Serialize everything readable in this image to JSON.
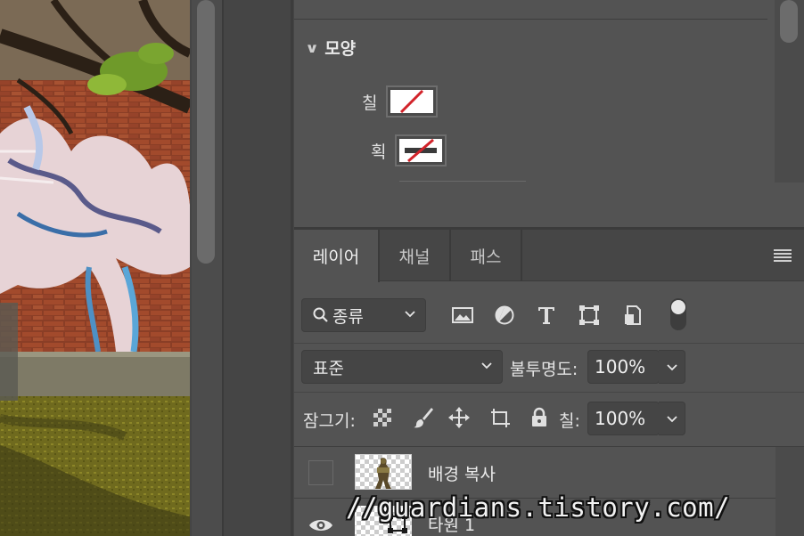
{
  "properties": {
    "section_title": "모양",
    "fill_label": "칠",
    "stroke_label": "획"
  },
  "layers_panel": {
    "tabs": [
      {
        "label": "레이어",
        "active": true
      },
      {
        "label": "채널",
        "active": false
      },
      {
        "label": "패스",
        "active": false
      }
    ],
    "filter": {
      "selected": "종류",
      "icons": [
        "image-filter-icon",
        "adjustment-filter-icon",
        "type-filter-icon",
        "shape-filter-icon",
        "smart-object-filter-icon"
      ]
    },
    "blend_mode": "표준",
    "opacity_label": "불투명도:",
    "opacity_value": "100%",
    "lock_label": "잠그기:",
    "lock_icons": [
      "lock-transparent-icon",
      "lock-paint-icon",
      "lock-position-icon",
      "lock-artboard-icon",
      "lock-all-icon"
    ],
    "fill_label": "칠:",
    "fill_value": "100%",
    "layers": [
      {
        "name": "배경 복사",
        "visible": false
      },
      {
        "name": "타원 1",
        "visible": true
      }
    ]
  },
  "watermark": "//guardians.tistory.com/",
  "colors": {
    "panel_bg": "#535353",
    "field_bg": "#454545",
    "no_fill_red": "#d2232a"
  }
}
